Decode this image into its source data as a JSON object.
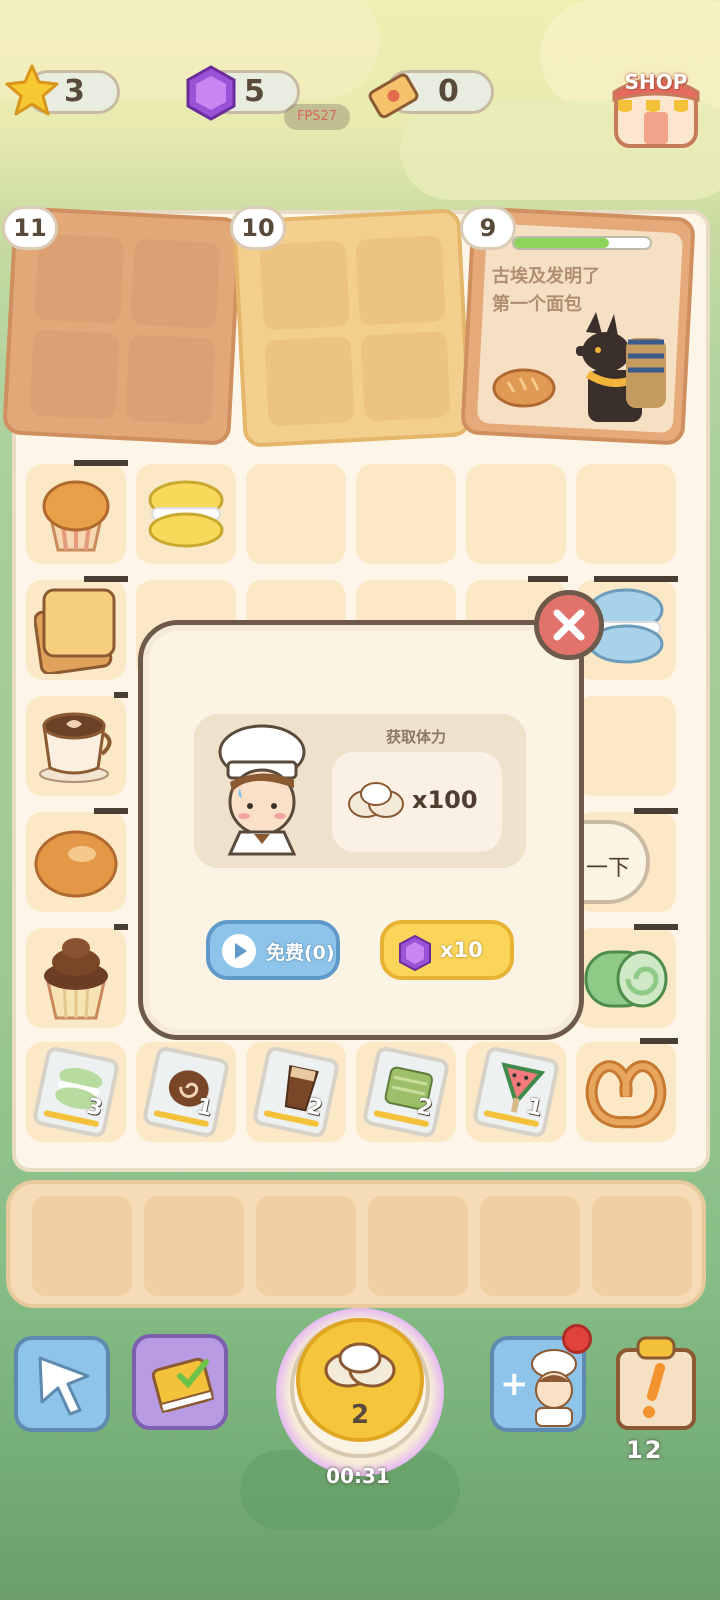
{
  "currencies": {
    "stars": "3",
    "gems": "5",
    "tickets": "0",
    "fps": "FPS27"
  },
  "shop": {
    "label": "SHOP"
  },
  "trays": [
    {
      "level": "11"
    },
    {
      "level": "10"
    },
    {
      "level": "9",
      "progress": 0.7,
      "info_line1": "古埃及发明了",
      "info_line2": "第一个面包"
    }
  ],
  "cards": [
    {
      "count": "3"
    },
    {
      "count": "1"
    },
    {
      "count": "2"
    },
    {
      "count": "2"
    },
    {
      "count": "1"
    }
  ],
  "side_button": {
    "label": "一下"
  },
  "modal": {
    "title": "获取体力",
    "reward_qty": "x100",
    "free_button": "免费(0)",
    "gem_button": "x10"
  },
  "bottom_bar": {
    "energy_count": "2",
    "timer": "00:31",
    "quest_count": "12"
  },
  "colors": {
    "accent_red": "#e1736c",
    "gem_purple": "#9a52d6",
    "star_yellow": "#f6c832",
    "free_blue": "#8ec4ea",
    "gem_button_yellow": "#fbd55a"
  }
}
